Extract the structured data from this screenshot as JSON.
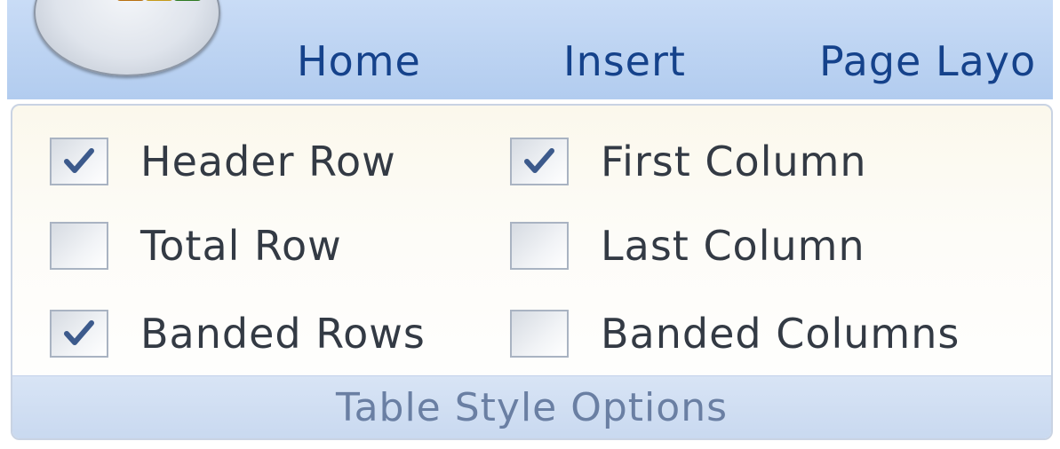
{
  "ribbon": {
    "tabs": [
      {
        "label": "Home"
      },
      {
        "label": "Insert"
      },
      {
        "label": "Page Layo"
      }
    ],
    "office_button_icon": "office-logo-icon"
  },
  "group": {
    "title": "Table Style Options",
    "options": [
      {
        "label": "Header Row",
        "checked": true
      },
      {
        "label": "First Column",
        "checked": true
      },
      {
        "label": "Total Row",
        "checked": false
      },
      {
        "label": "Last Column",
        "checked": false
      },
      {
        "label": "Banded Rows",
        "checked": true
      },
      {
        "label": "Banded Columns",
        "checked": false
      }
    ]
  },
  "colors": {
    "tab_text": "#15428b",
    "tab_bar": "#bcd3f2",
    "footer": "#c9d9f0"
  }
}
